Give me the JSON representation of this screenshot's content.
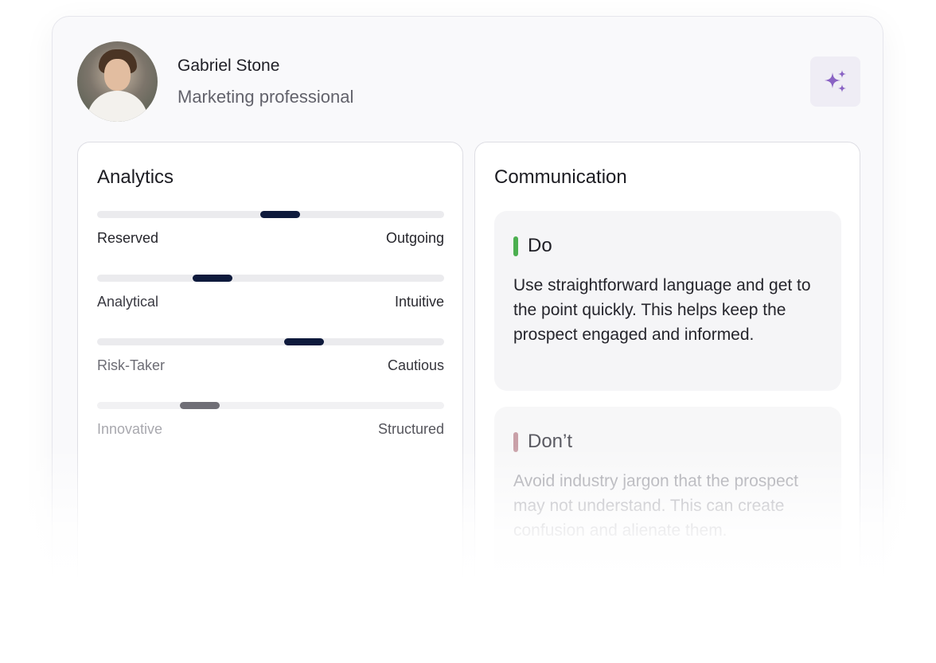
{
  "profile": {
    "name": "Gabriel Stone",
    "role": "Marketing professional"
  },
  "ai_button": {
    "icon": "sparkles-icon",
    "color": "#8a63c4"
  },
  "analytics": {
    "title": "Analytics",
    "traits": [
      {
        "left": "Reserved",
        "right": "Outgoing",
        "value": 0.53
      },
      {
        "left": "Analytical",
        "right": "Intuitive",
        "value": 0.31
      },
      {
        "left": "Risk-Taker",
        "right": "Cautious",
        "value": 0.61
      },
      {
        "left": "Innovative",
        "right": "Structured",
        "value": 0.27
      }
    ]
  },
  "communication": {
    "title": "Communication",
    "do": {
      "heading": "Do",
      "text": "Use straightforward language and get to the point quickly. This helps keep the prospect engaged and informed.",
      "accent": "#4caf50"
    },
    "dont": {
      "heading": "Don’t",
      "text": "Avoid industry jargon that the prospect may not understand. This can create confusion and alienate them.",
      "accent": "#c9a0a8"
    }
  }
}
